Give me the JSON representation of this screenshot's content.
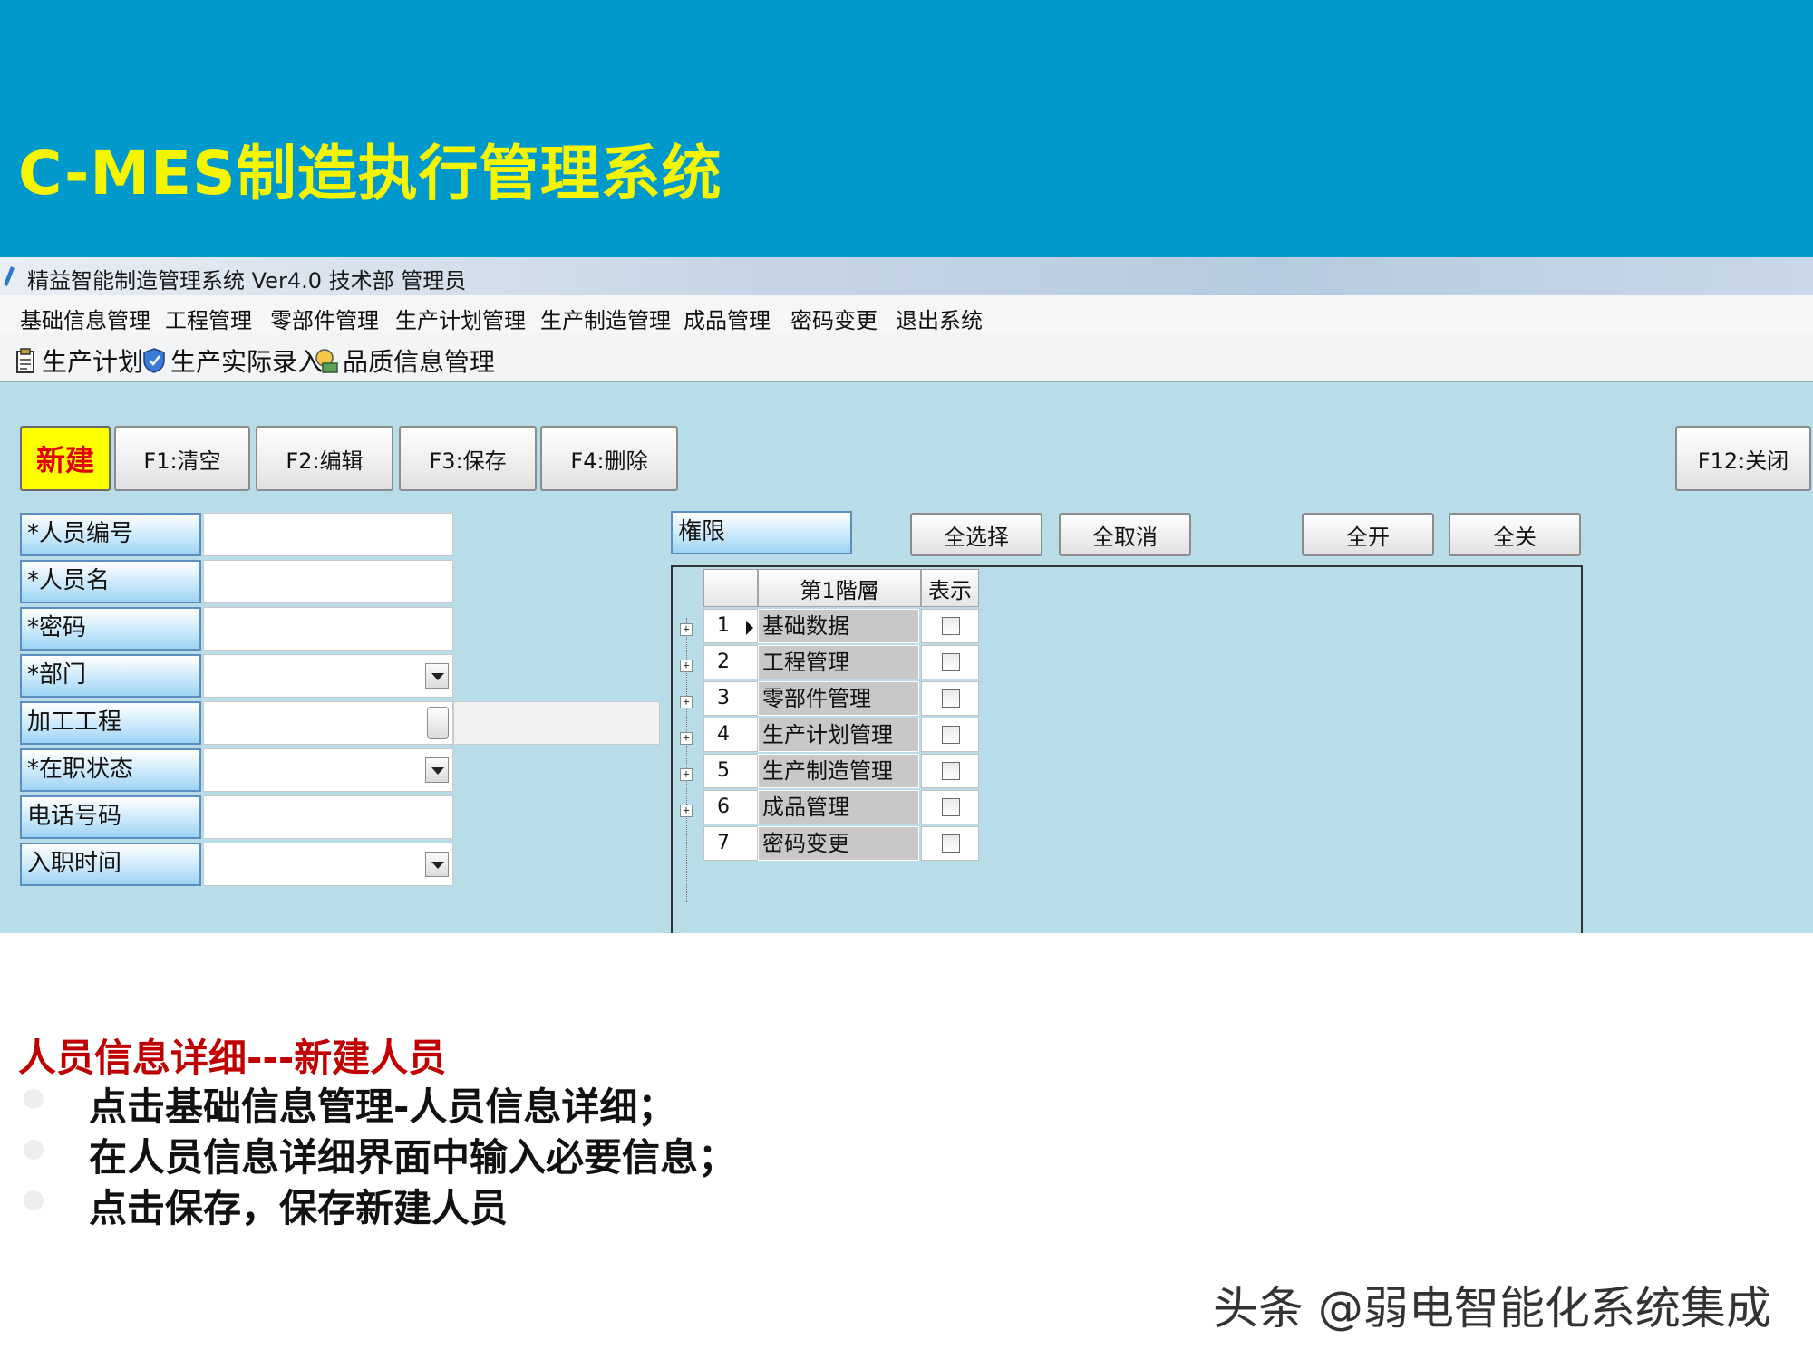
{
  "slide": {
    "title": "C-MES制造执行管理系统"
  },
  "app": {
    "window_title": "精益智能制造管理系统 Ver4.0 技术部 管理员",
    "menu": [
      "基础信息管理",
      "工程管理",
      "零部件管理",
      "生产计划管理",
      "生产制造管理",
      "成品管理",
      "密码变更",
      "退出系统"
    ],
    "toolbar": [
      {
        "label": "生产计划",
        "icon": "clipboard-icon"
      },
      {
        "label": "生产实际录入",
        "icon": "shield-icon"
      },
      {
        "label": "品质信息管理",
        "icon": "quality-icon"
      }
    ],
    "buttons": {
      "new": "新建",
      "clear": "F1:清空",
      "edit": "F2:编辑",
      "save": "F3:保存",
      "delete": "F4:删除",
      "close": "F12:关闭"
    },
    "fields": [
      {
        "label": "*人员编号",
        "value": "",
        "type": "text"
      },
      {
        "label": "*人员名",
        "value": "",
        "type": "text"
      },
      {
        "label": "*密码",
        "value": "",
        "type": "text"
      },
      {
        "label": "*部门",
        "value": "",
        "type": "select"
      },
      {
        "label": "加工工程",
        "value": "",
        "type": "picker"
      },
      {
        "label": "*在职状态",
        "value": "",
        "type": "select"
      },
      {
        "label": "电话号码",
        "value": "",
        "type": "text"
      },
      {
        "label": "入职时间",
        "value": "",
        "type": "select"
      }
    ],
    "permission": {
      "label": "権限",
      "select_all": "全选择",
      "cancel_all": "全取消",
      "expand_all": "全开",
      "collapse_all": "全关",
      "columns": [
        "第1階層",
        "表示"
      ],
      "rows": [
        {
          "no": "1",
          "name": "基础数据",
          "checked": false
        },
        {
          "no": "2",
          "name": "工程管理",
          "checked": false
        },
        {
          "no": "3",
          "name": "零部件管理",
          "checked": false
        },
        {
          "no": "4",
          "name": "生产计划管理",
          "checked": false
        },
        {
          "no": "5",
          "name": "生产制造管理",
          "checked": false
        },
        {
          "no": "6",
          "name": "成品管理",
          "checked": false
        },
        {
          "no": "7",
          "name": "密码变更",
          "checked": false
        }
      ]
    }
  },
  "caption": {
    "title": "人员信息详细---新建人员",
    "bullets": [
      "点击基础信息管理-人员信息详细；",
      "在人员信息详细界面中输入必要信息；",
      "点击保存，保存新建人员"
    ]
  },
  "watermark": "头条 @弱电智能化系统集成",
  "colors": {
    "header_bg": "#0099cc",
    "title_yellow": "#f5f500",
    "app_bg": "#b8dde8",
    "caption_red": "#c00000",
    "new_button_bg": "#ffff00"
  }
}
